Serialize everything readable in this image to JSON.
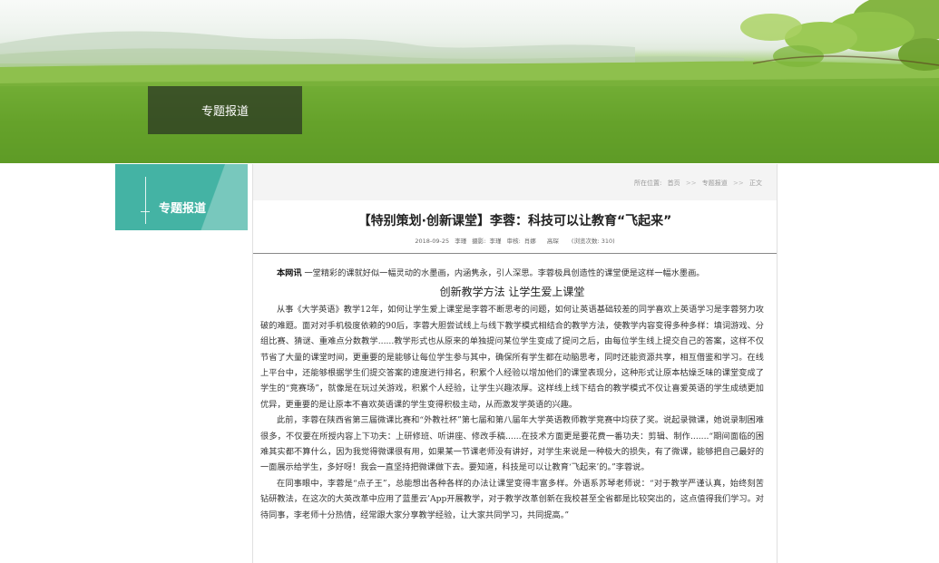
{
  "banner": {
    "title": "专题报道"
  },
  "sidebar": {
    "title": "专题报道"
  },
  "breadcrumb": {
    "prefix": "所在位置:",
    "items": [
      "首页",
      "专题报道",
      "正文"
    ],
    "separator": ">>"
  },
  "article": {
    "title": "【特别策划·创新课堂】李蓉：科技可以让教育“飞起来”",
    "meta": {
      "date": "2018-09-25",
      "author": "李瑾",
      "photo_label": "摄影:",
      "photographer": "李瑾",
      "review_label": "审核:",
      "reviewer1": "肖娜",
      "reviewer2": "高琛",
      "views": "(浏览次数: 310)"
    },
    "lead_label": "本网讯",
    "lead_text": "一堂精彩的课就好似一幅灵动的水墨画，内涵隽永，引人深思。李蓉极具创造性的课堂便是这样一幅水墨画。",
    "section_heading": "创新教学方法 让学生爱上课堂",
    "paragraphs": [
      "从事《大学英语》教学12年，如何让学生爱上课堂是李蓉不断思考的问题，如何让英语基础较差的同学喜欢上英语学习是李蓉努力攻破的难题。面对对手机极度依赖的90后，李蓉大胆尝试线上与线下教学模式相结合的教学方法，使教学内容变得多种多样：填词游戏、分组比赛、猜谜、重难点分数教学......教学形式也从原来的单独提问某位学生变成了提问之后，由每位学生线上提交自己的答案，这样不仅节省了大量的课堂时间，更重要的是能够让每位学生参与其中，确保所有学生都在动脑思考，同时还能资源共享，相互借鉴和学习。在线上平台中，还能够根据学生们提交答案的速度进行排名，积累个人经验以增加他们的课堂表现分，这种形式让原本枯燥乏味的课堂变成了学生的“竞赛场”，就像是在玩过关游戏，积累个人经验，让学生兴趣浓厚。这样线上线下结合的教学模式不仅让喜爱英语的学生成绩更加优异，更重要的是让原本不喜欢英语课的学生变得积极主动，从而激发学英语的兴趣。",
      "此前，李蓉在陕西省第三届微课比赛和“外教社杯”第七届和第八届年大学英语教师教学竞赛中均获了奖。说起录微课，她说录制困难很多，不仅要在所授内容上下功夫：上研修班、听讲座、修改手稿......在技术方面更是要花费一番功夫：剪辑、制作.......“期间面临的困难其实都不算什么，因为我觉得微课很有用，如果某一节课老师没有讲好，对学生来说是一种极大的损失，有了微课，能够把自己最好的一面展示给学生，多好呀！我会一直坚持把微课做下去。要知道，科技是可以让教育‘飞起来’的。”李蓉说。",
      "在同事眼中，李蓉是“点子王”，总能想出各种各样的办法让课堂变得丰富多样。外语系苏琴老师说：“对于教学严谨认真，始终刻苦钻研教法，在这次的大英改革中应用了蓝墨云’App开展教学，对于教学改革创新在我校甚至全省都是比较突出的，这点值得我们学习。对待同事，李老师十分热情，经常跟大家分享教学经验，让大家共同学习，共同提高。”"
    ]
  }
}
